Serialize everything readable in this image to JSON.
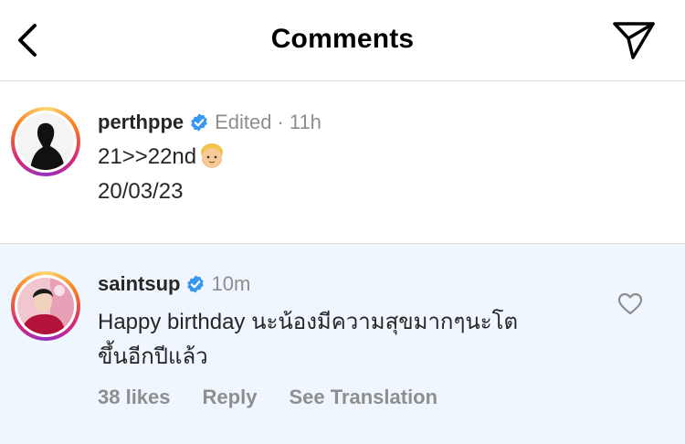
{
  "header": {
    "title": "Comments",
    "back_icon": "chevron-left-icon",
    "share_icon": "paper-plane-icon"
  },
  "caption": {
    "username": "perthppe",
    "verified": true,
    "edited_label": "Edited",
    "separator": "·",
    "time": "11h",
    "line1": "21>>22nd",
    "line1_emoji": "👨‍🦲",
    "line2": "20/03/23"
  },
  "comment": {
    "username": "saintsup",
    "verified": true,
    "time": "10m",
    "line1": "Happy birthday นะน้องมีความสุขมากๆนะโต",
    "line2": "ขึ้นอีกปีแล้ว",
    "likes": "38 likes",
    "reply": "Reply",
    "see_translation": "See Translation"
  },
  "colors": {
    "verified": "#3897f0",
    "muted": "#8e8e8e",
    "highlight_bg": "#eff6fd",
    "divider": "#dbdbdb"
  }
}
